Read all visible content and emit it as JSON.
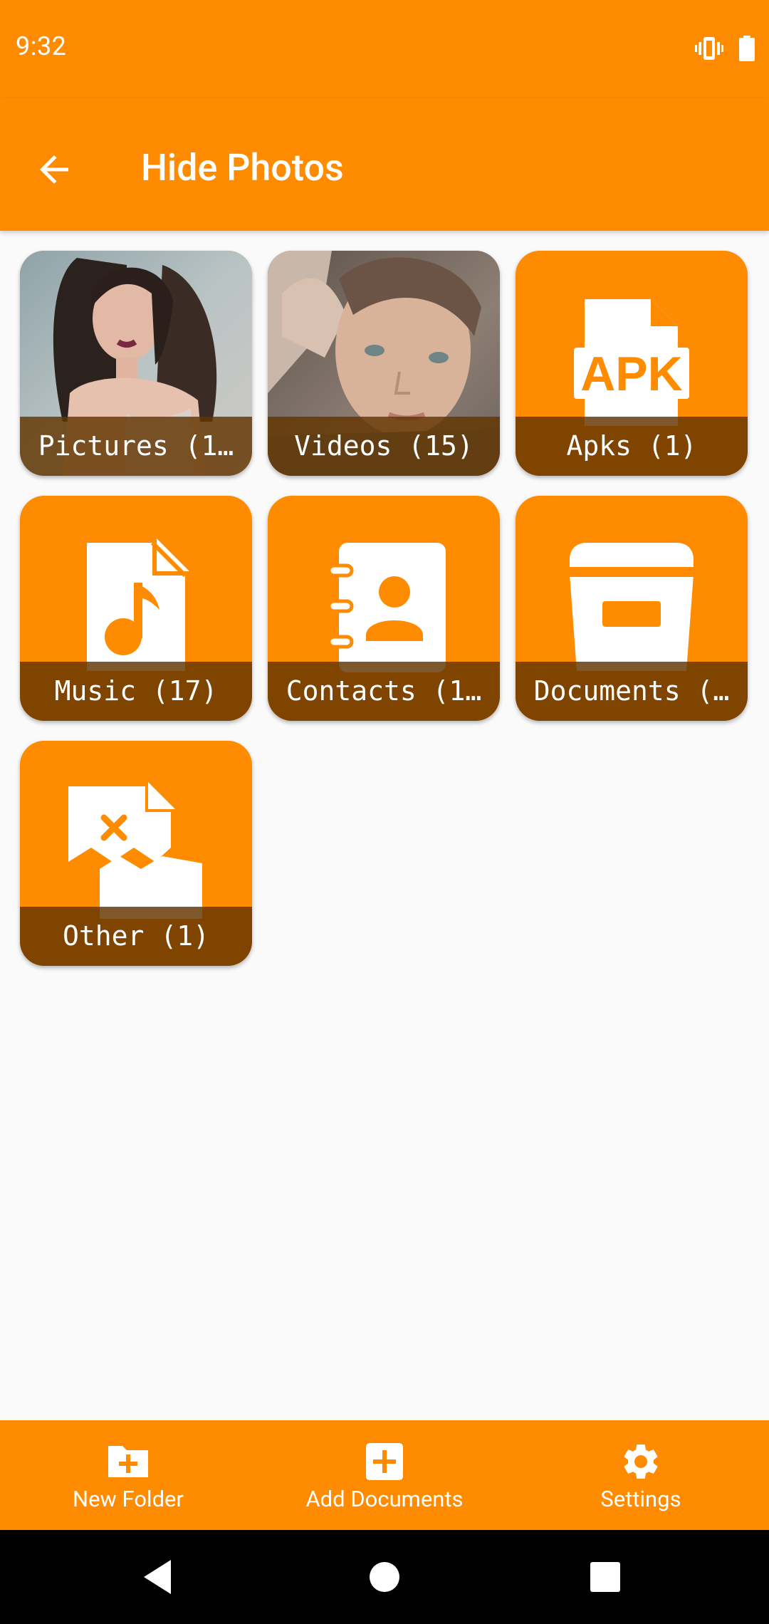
{
  "status_bar": {
    "time": "9:32",
    "icons": [
      "vibrate-icon",
      "battery-icon"
    ]
  },
  "app_bar": {
    "title": "Hide Photos",
    "back_icon": "arrow-back-icon"
  },
  "tiles": [
    {
      "label": "Pictures (1…",
      "type": "photo"
    },
    {
      "label": "Videos (15)",
      "type": "photo"
    },
    {
      "label": "Apks (1)",
      "icon": "apk-file-icon"
    },
    {
      "label": "Music (17)",
      "icon": "music-file-icon"
    },
    {
      "label": "Contacts (1…",
      "icon": "contacts-book-icon"
    },
    {
      "label": "Documents (…",
      "icon": "archive-box-icon"
    },
    {
      "label": "Other (1)",
      "icon": "broken-file-icon"
    }
  ],
  "bottom_nav": [
    {
      "label": "New Folder",
      "icon": "folder-plus-icon"
    },
    {
      "label": "Add Documents",
      "icon": "add-box-icon"
    },
    {
      "label": "Settings",
      "icon": "gear-icon"
    }
  ],
  "colors": {
    "primary": "#ff8b00",
    "label_overlay": "#613400",
    "background": "#fafafa"
  }
}
